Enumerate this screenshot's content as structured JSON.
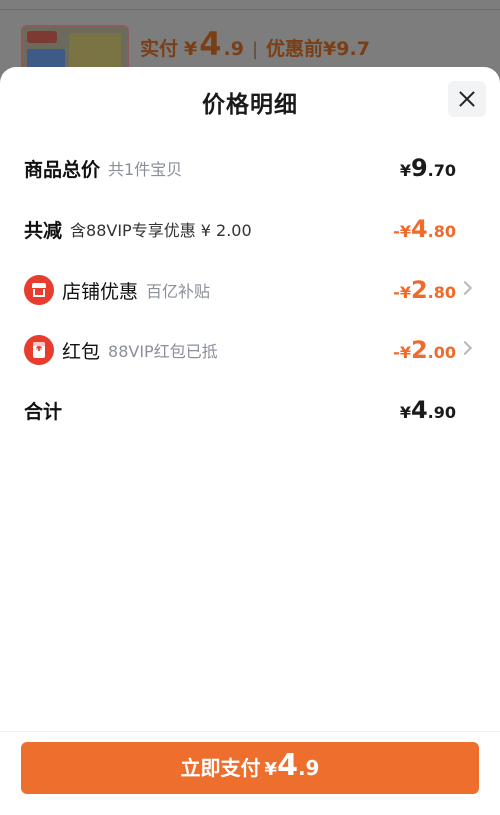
{
  "background": {
    "pay_label": "实付",
    "currency": "¥",
    "pay_int": "4",
    "pay_dec": ".9",
    "separator": "|",
    "before_discount_label": "优惠前¥9.7"
  },
  "sheet": {
    "title": "价格明细",
    "close_icon": "close-icon",
    "rows": [
      {
        "label": "商品总价",
        "sub": "共1件宝贝",
        "yen": "¥",
        "int": "9",
        "dec": ".70"
      },
      {
        "label": "共减",
        "sub": "含88VIP专享优惠 ¥ 2.00",
        "yen": "-¥",
        "int": "4",
        "dec": ".80"
      },
      {
        "icon": "shop-icon",
        "label": "店铺优惠",
        "sub": "百亿补贴",
        "yen": "-¥",
        "int": "2",
        "dec": ".80"
      },
      {
        "icon": "red-packet-icon",
        "label": "红包",
        "sub": "88VIP红包已抵",
        "yen": "-¥",
        "int": "2",
        "dec": ".00"
      },
      {
        "label": "合计",
        "yen": "¥",
        "int": "4",
        "dec": ".90"
      }
    ]
  },
  "footer": {
    "pay_button_label": "立即支付",
    "yen": "¥",
    "int": "4",
    "dec": ".9"
  },
  "colors": {
    "accent": "#ee6e2d",
    "discount_text": "#ef6a2b",
    "icon_red": "#e83c2e",
    "sub_text": "#8a8f99"
  }
}
